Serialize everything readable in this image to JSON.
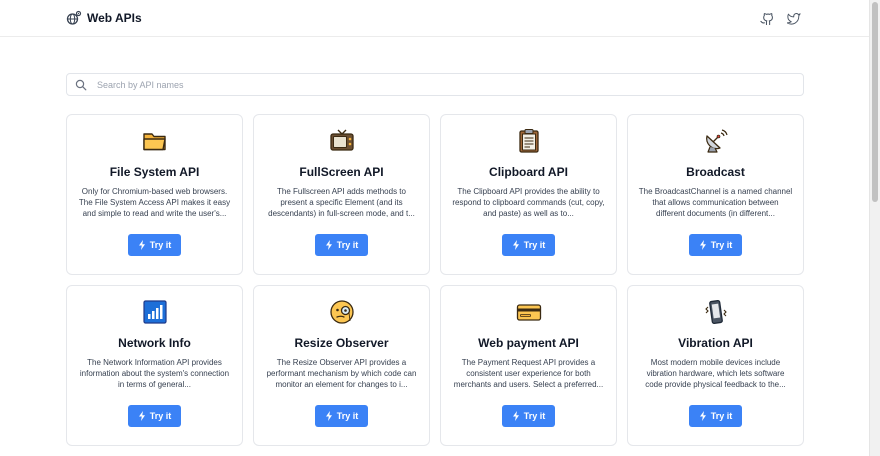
{
  "header": {
    "title": "Web APIs",
    "icons": [
      "github-icon",
      "twitter-icon"
    ]
  },
  "search": {
    "placeholder": "Search by API names",
    "value": ""
  },
  "colors": {
    "button": "#3b82f6",
    "border": "#e5e7eb"
  },
  "cards": [
    {
      "title": "File System API",
      "description": "Only for Chromium-based web browsers. The File System Access API makes it easy and simple to read and write the user's...",
      "button": "Try it",
      "icon": "folder-icon"
    },
    {
      "title": "FullScreen API",
      "description": "The Fullscreen API adds methods to present a specific Element (and its descendants) in full-screen mode, and t...",
      "button": "Try it",
      "icon": "television-icon"
    },
    {
      "title": "Clipboard API",
      "description": "The Clipboard API provides the ability to respond to clipboard commands (cut, copy, and paste) as well as to...",
      "button": "Try it",
      "icon": "clipboard-icon"
    },
    {
      "title": "Broadcast",
      "description": "The BroadcastChannel is a named channel that allows communication between different documents (in different...",
      "button": "Try it",
      "icon": "satellite-antenna-icon"
    },
    {
      "title": "Network Info",
      "description": "The Network Information API provides information about the system's connection in terms of general...",
      "button": "Try it",
      "icon": "signal-bars-icon"
    },
    {
      "title": "Resize Observer",
      "description": "The Resize Observer API provides a performant mechanism by which code can monitor an element for changes to i...",
      "button": "Try it",
      "icon": "monocle-face-icon"
    },
    {
      "title": "Web payment API",
      "description": "The Payment Request API provides a consistent user experience for both merchants and users. Select a preferred...",
      "button": "Try it",
      "icon": "credit-card-icon"
    },
    {
      "title": "Vibration API",
      "description": "Most modern mobile devices include vibration hardware, which lets software code provide physical feedback to the...",
      "button": "Try it",
      "icon": "vibrating-phone-icon"
    }
  ]
}
